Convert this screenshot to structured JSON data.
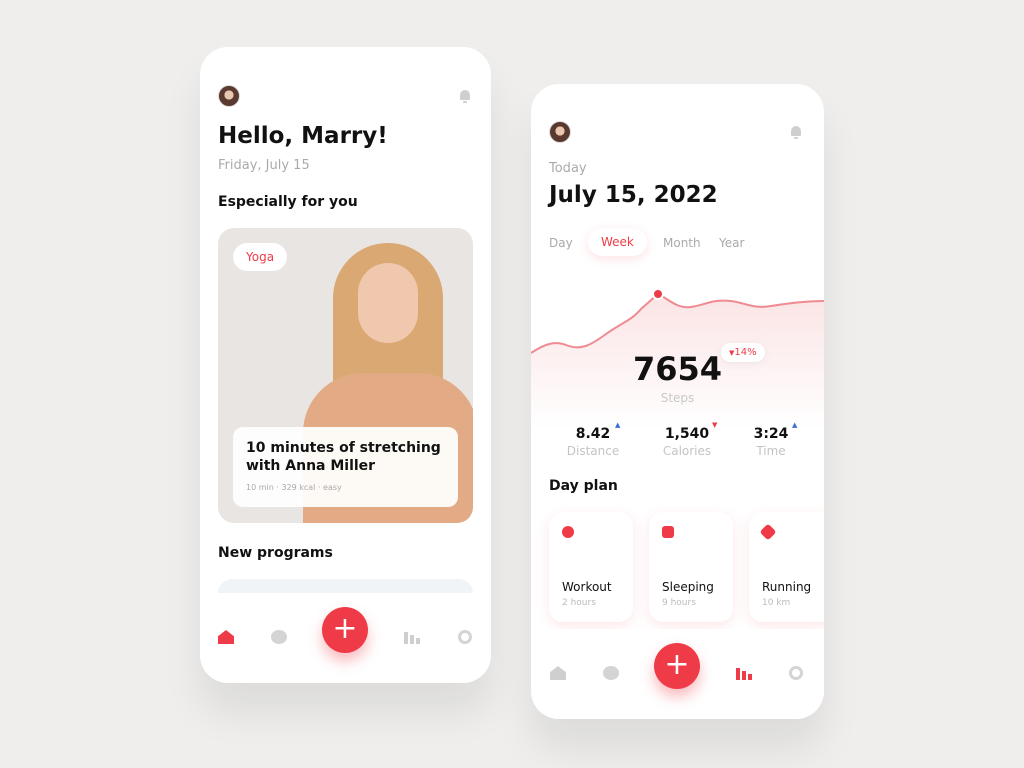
{
  "home_screen": {
    "greeting": "Hello, Marry!",
    "date": "Friday, July 15",
    "section_title": "Especially for you",
    "featured": {
      "tag": "Yoga",
      "title_line1": "10 minutes of stretching",
      "title_line2": "with Anna Miller",
      "meta": "10 min · 329 kcal · easy"
    },
    "new_programs_title": "New programs",
    "nav": [
      "home-icon",
      "chat-icon",
      "plus-icon",
      "stats-icon",
      "award-icon"
    ],
    "plus": "+"
  },
  "stats_screen": {
    "label": "Today",
    "date": "July 15, 2022",
    "tabs": [
      "Day",
      "Week",
      "Month",
      "Year"
    ],
    "active_tab": "Week",
    "steps": "7654",
    "steps_label": "Steps",
    "change": "14%",
    "stats": [
      {
        "value": "8.42",
        "label": "Distance",
        "trend": "up"
      },
      {
        "value": "1,540",
        "label": "Calories",
        "trend": "down"
      },
      {
        "value": "3:24",
        "label": "Time",
        "trend": "up"
      }
    ],
    "day_plan_title": "Day plan",
    "plans": [
      {
        "title": "Workout",
        "sub": "2 hours"
      },
      {
        "title": "Sleeping",
        "sub": "9 hours"
      },
      {
        "title": "Running",
        "sub": "10 km"
      }
    ],
    "plus": "+"
  },
  "colors": {
    "accent": "#ef3b47",
    "up": "#3b6fd8",
    "background": "#efeeed"
  }
}
